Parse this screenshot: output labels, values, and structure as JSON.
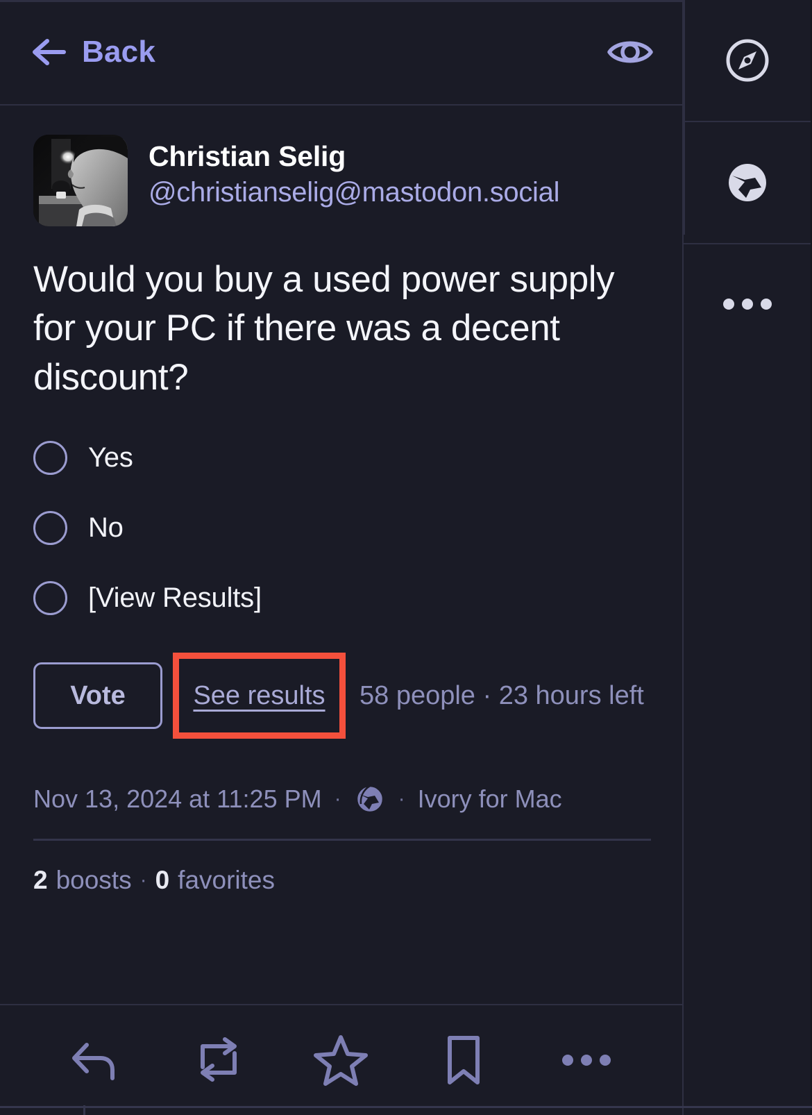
{
  "navbar": {
    "back_label": "Back",
    "back_icon": "arrow-left-icon",
    "visibility_icon": "eye-icon"
  },
  "post": {
    "author": {
      "display_name": "Christian Selig",
      "handle": "@christianselig@mastodon.social",
      "avatar_alt": "avatar"
    },
    "content": "Would you buy a used power supply for your PC if there was a decent discount?",
    "poll": {
      "options": [
        {
          "label": "Yes"
        },
        {
          "label": "No"
        },
        {
          "label": "[View Results]"
        }
      ],
      "vote_label": "Vote",
      "see_results_label": "See results",
      "meta": "58 people · 23 hours left",
      "voters_count": "58",
      "time_left": "23 hours left"
    },
    "meta": {
      "timestamp": "Nov 13, 2024 at 11:25 PM",
      "separator": "·",
      "visibility_icon": "globe-icon",
      "app": "Ivory for Mac"
    },
    "stats": {
      "boosts_count": "2",
      "boosts_label": "boosts",
      "separator": "·",
      "favorites_count": "0",
      "favorites_label": "favorites"
    }
  },
  "actionbar": {
    "items": [
      {
        "name": "reply-icon",
        "label": "Reply"
      },
      {
        "name": "boost-icon",
        "label": "Boost"
      },
      {
        "name": "favorite-star-icon",
        "label": "Favorite"
      },
      {
        "name": "bookmark-icon",
        "label": "Bookmark"
      },
      {
        "name": "more-icon",
        "label": "More"
      }
    ]
  },
  "sidebar": {
    "items": [
      {
        "name": "compass-explore-icon",
        "label": "Explore"
      },
      {
        "name": "globe-icon",
        "label": "Federated"
      },
      {
        "name": "more-icon",
        "label": "More"
      }
    ]
  },
  "colors": {
    "background": "#1a1b26",
    "accent": "#9a9cf0",
    "muted_text": "#8e90bb",
    "primary_text": "#f4f5fa",
    "border": "#2e2f42",
    "highlight": "#f4503c"
  }
}
